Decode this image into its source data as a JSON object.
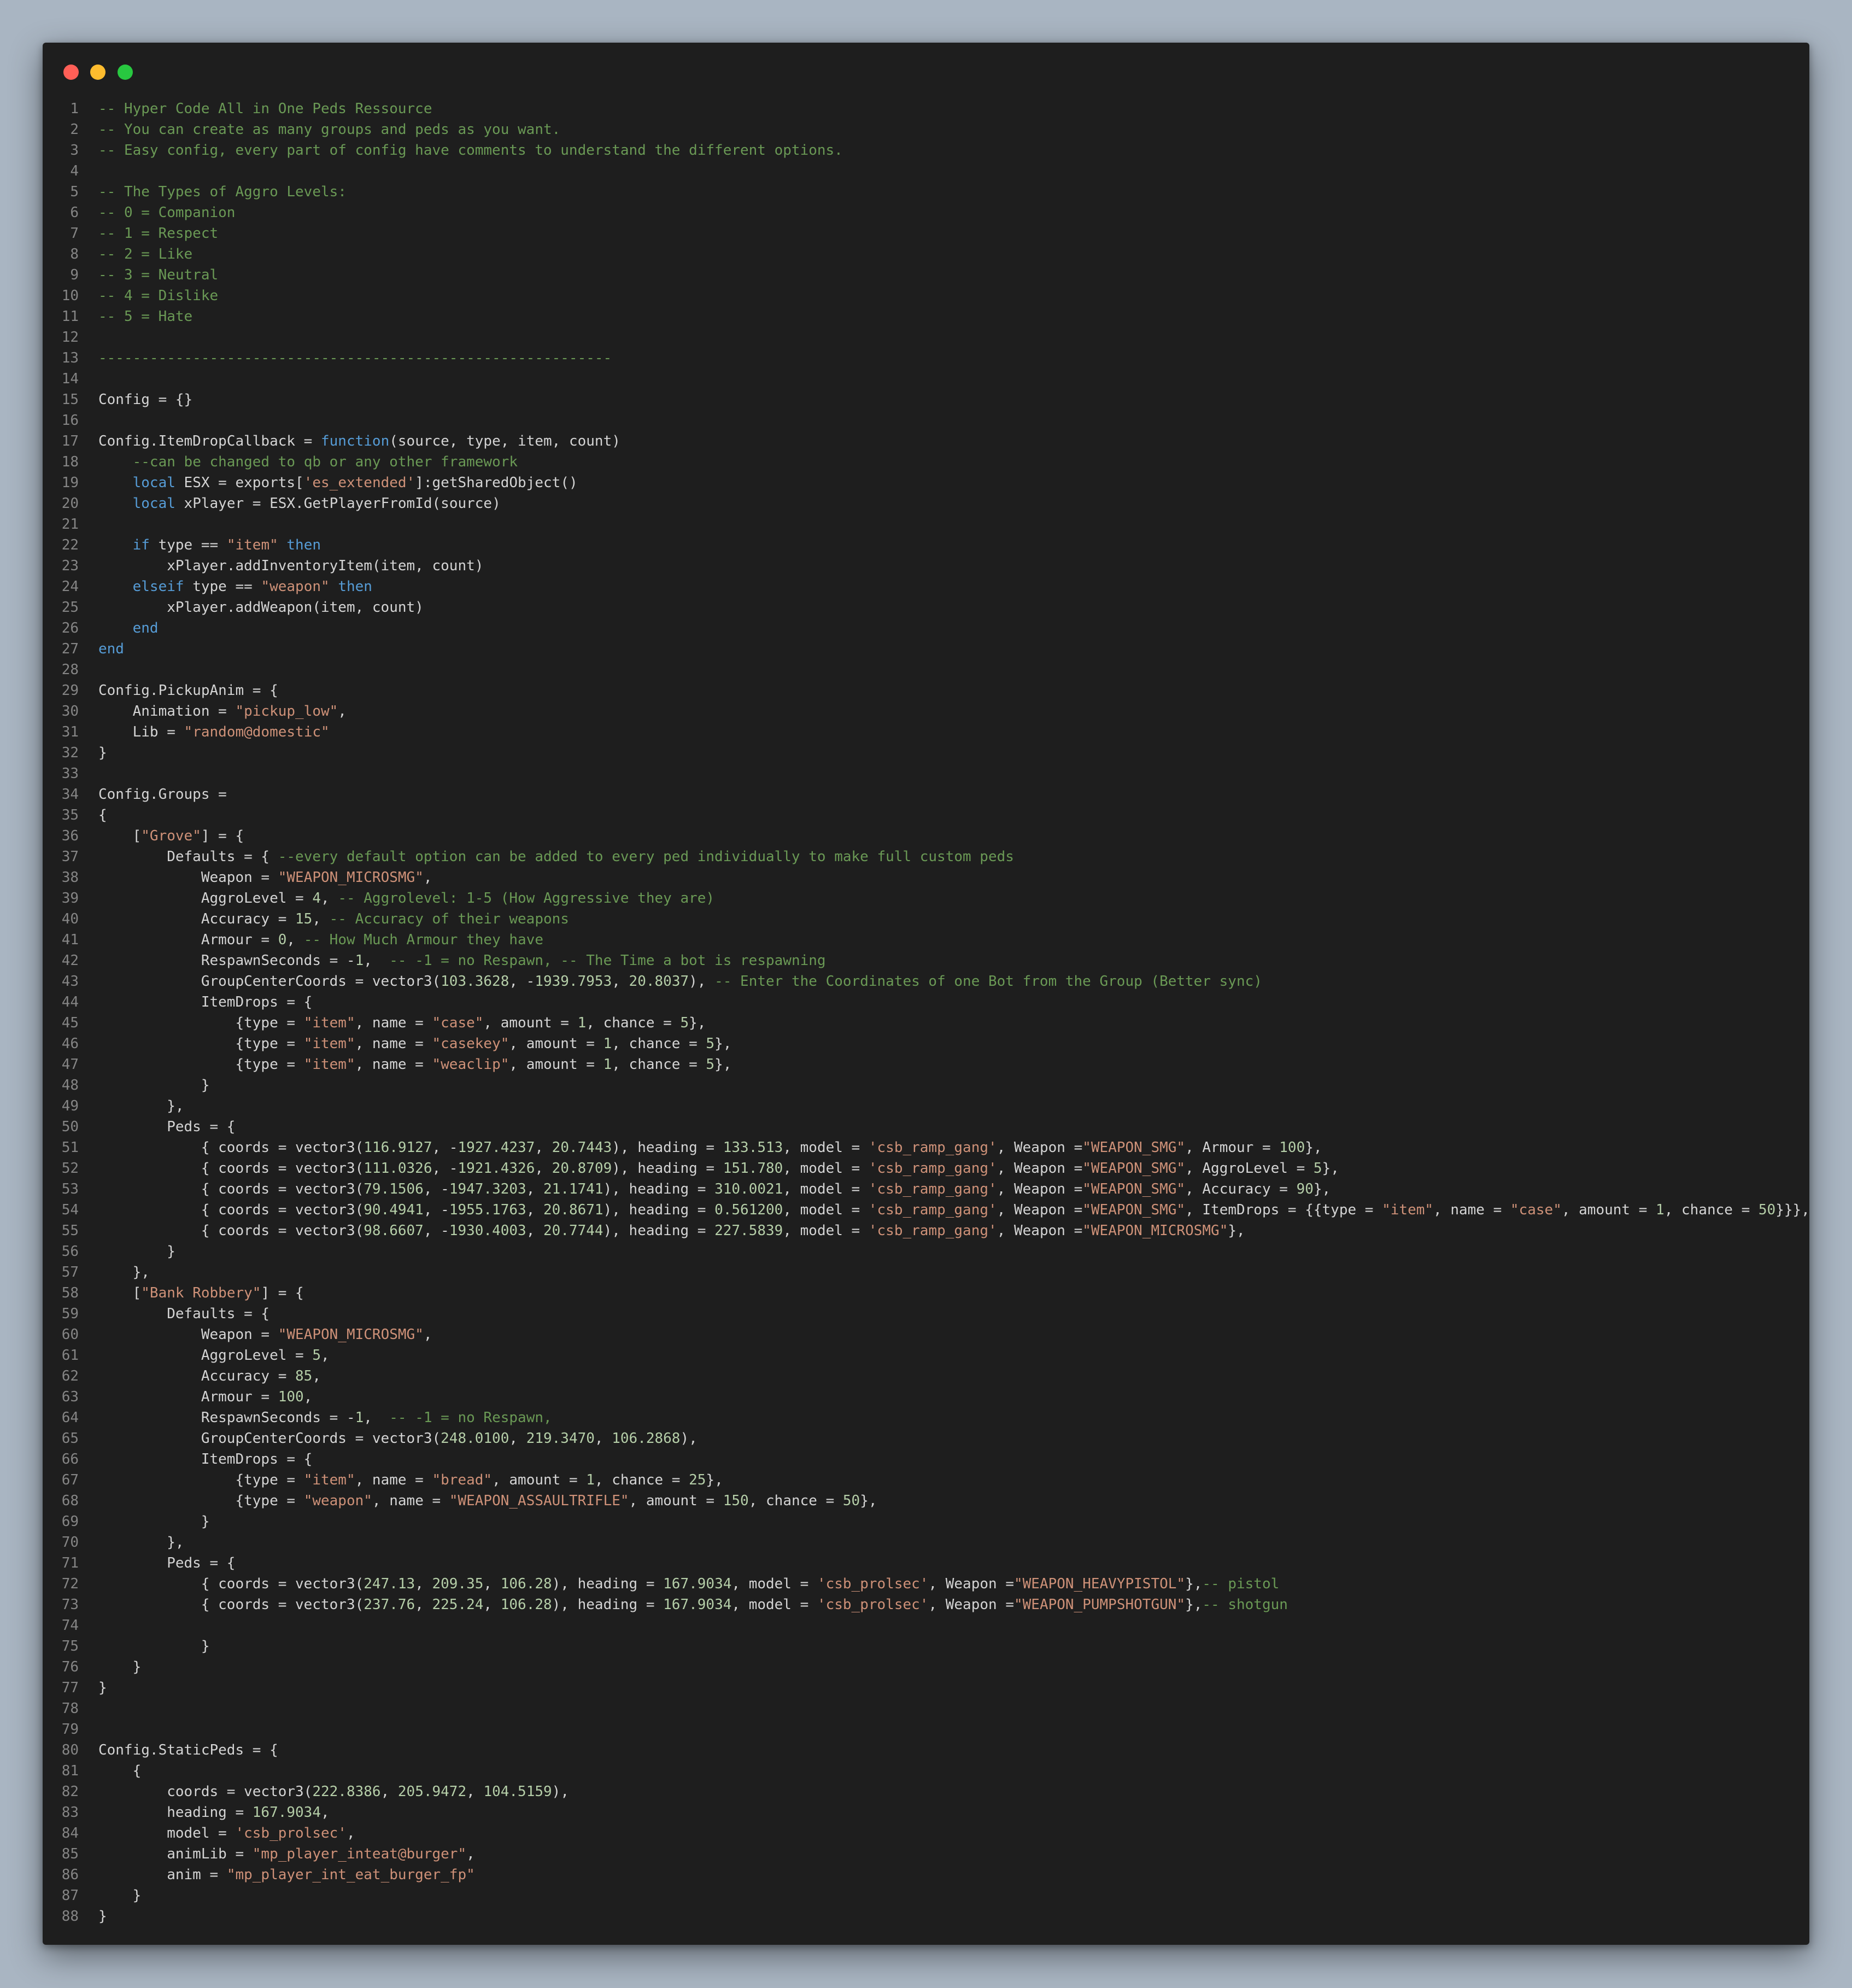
{
  "window": {
    "controls": [
      "close-dot",
      "minimize-dot",
      "maximize-dot"
    ],
    "colors": {
      "close": "#ff5f57",
      "minimize": "#febc2e",
      "maximize": "#28c840",
      "background": "#1e1e1e",
      "comment": "#6a9955",
      "keyword": "#569cd6",
      "string": "#ce9178",
      "number": "#b5cea8",
      "text": "#d4d4d4",
      "line_number": "#858585"
    }
  },
  "code": {
    "lines": [
      [
        [
          "c",
          "-- Hyper Code All in One Peds Ressource"
        ]
      ],
      [
        [
          "c",
          "-- You can create as many groups and peds as you want."
        ]
      ],
      [
        [
          "c",
          "-- Easy config, every part of config have comments to understand the different options."
        ]
      ],
      [],
      [
        [
          "c",
          "-- The Types of Aggro Levels:"
        ]
      ],
      [
        [
          "c",
          "-- 0 = Companion"
        ]
      ],
      [
        [
          "c",
          "-- 1 = Respect"
        ]
      ],
      [
        [
          "c",
          "-- 2 = Like"
        ]
      ],
      [
        [
          "c",
          "-- 3 = Neutral"
        ]
      ],
      [
        [
          "c",
          "-- 4 = Dislike"
        ]
      ],
      [
        [
          "c",
          "-- 5 = Hate"
        ]
      ],
      [],
      [
        [
          "c",
          "------------------------------------------------------------"
        ]
      ],
      [],
      [
        [
          "p",
          "Config = {}"
        ]
      ],
      [],
      [
        [
          "p",
          "Config.ItemDropCallback = "
        ],
        [
          "k",
          "function"
        ],
        [
          "p",
          "(source, type, item, count)"
        ]
      ],
      [
        [
          "p",
          "    "
        ],
        [
          "c",
          "--can be changed to qb or any other framework"
        ]
      ],
      [
        [
          "p",
          "    "
        ],
        [
          "k",
          "local"
        ],
        [
          "p",
          " ESX = exports["
        ],
        [
          "s",
          "'es_extended'"
        ],
        [
          "p",
          "]:getSharedObject()"
        ]
      ],
      [
        [
          "p",
          "    "
        ],
        [
          "k",
          "local"
        ],
        [
          "p",
          " xPlayer = ESX.GetPlayerFromId(source)"
        ]
      ],
      [],
      [
        [
          "p",
          "    "
        ],
        [
          "k",
          "if"
        ],
        [
          "p",
          " type == "
        ],
        [
          "s",
          "\"item\""
        ],
        [
          "p",
          " "
        ],
        [
          "k",
          "then"
        ]
      ],
      [
        [
          "p",
          "        xPlayer.addInventoryItem(item, count)"
        ]
      ],
      [
        [
          "p",
          "    "
        ],
        [
          "k",
          "elseif"
        ],
        [
          "p",
          " type == "
        ],
        [
          "s",
          "\"weapon\""
        ],
        [
          "p",
          " "
        ],
        [
          "k",
          "then"
        ]
      ],
      [
        [
          "p",
          "        xPlayer.addWeapon(item, count)"
        ]
      ],
      [
        [
          "p",
          "    "
        ],
        [
          "k",
          "end"
        ]
      ],
      [
        [
          "k",
          "end"
        ]
      ],
      [],
      [
        [
          "p",
          "Config.PickupAnim = {"
        ]
      ],
      [
        [
          "p",
          "    Animation = "
        ],
        [
          "s",
          "\"pickup_low\""
        ],
        [
          "p",
          ","
        ]
      ],
      [
        [
          "p",
          "    Lib = "
        ],
        [
          "s",
          "\"random@domestic\""
        ]
      ],
      [
        [
          "p",
          "}"
        ]
      ],
      [],
      [
        [
          "p",
          "Config.Groups ="
        ]
      ],
      [
        [
          "p",
          "{"
        ]
      ],
      [
        [
          "p",
          "    ["
        ],
        [
          "s",
          "\"Grove\""
        ],
        [
          "p",
          "] = {"
        ]
      ],
      [
        [
          "p",
          "        Defaults = { "
        ],
        [
          "c",
          "--every default option can be added to every ped individually to make full custom peds"
        ]
      ],
      [
        [
          "p",
          "            Weapon = "
        ],
        [
          "s",
          "\"WEAPON_MICROSMG\""
        ],
        [
          "p",
          ","
        ]
      ],
      [
        [
          "p",
          "            AggroLevel = "
        ],
        [
          "n",
          "4"
        ],
        [
          "p",
          ", "
        ],
        [
          "c",
          "-- Aggrolevel: 1-5 (How Aggressive they are)"
        ]
      ],
      [
        [
          "p",
          "            Accuracy = "
        ],
        [
          "n",
          "15"
        ],
        [
          "p",
          ", "
        ],
        [
          "c",
          "-- Accuracy of their weapons"
        ]
      ],
      [
        [
          "p",
          "            Armour = "
        ],
        [
          "n",
          "0"
        ],
        [
          "p",
          ", "
        ],
        [
          "c",
          "-- How Much Armour they have"
        ]
      ],
      [
        [
          "p",
          "            RespawnSeconds = -"
        ],
        [
          "n",
          "1"
        ],
        [
          "p",
          ",  "
        ],
        [
          "c",
          "-- -1 = no Respawn, -- The Time a bot is respawning"
        ]
      ],
      [
        [
          "p",
          "            GroupCenterCoords = vector3("
        ],
        [
          "n",
          "103.3628"
        ],
        [
          "p",
          ", -"
        ],
        [
          "n",
          "1939.7953"
        ],
        [
          "p",
          ", "
        ],
        [
          "n",
          "20.8037"
        ],
        [
          "p",
          "), "
        ],
        [
          "c",
          "-- Enter the Coordinates of one Bot from the Group (Better sync)"
        ]
      ],
      [
        [
          "p",
          "            ItemDrops = {"
        ]
      ],
      [
        [
          "p",
          "                {type = "
        ],
        [
          "s",
          "\"item\""
        ],
        [
          "p",
          ", name = "
        ],
        [
          "s",
          "\"case\""
        ],
        [
          "p",
          ", amount = "
        ],
        [
          "n",
          "1"
        ],
        [
          "p",
          ", chance = "
        ],
        [
          "n",
          "5"
        ],
        [
          "p",
          "},"
        ]
      ],
      [
        [
          "p",
          "                {type = "
        ],
        [
          "s",
          "\"item\""
        ],
        [
          "p",
          ", name = "
        ],
        [
          "s",
          "\"casekey\""
        ],
        [
          "p",
          ", amount = "
        ],
        [
          "n",
          "1"
        ],
        [
          "p",
          ", chance = "
        ],
        [
          "n",
          "5"
        ],
        [
          "p",
          "},"
        ]
      ],
      [
        [
          "p",
          "                {type = "
        ],
        [
          "s",
          "\"item\""
        ],
        [
          "p",
          ", name = "
        ],
        [
          "s",
          "\"weaclip\""
        ],
        [
          "p",
          ", amount = "
        ],
        [
          "n",
          "1"
        ],
        [
          "p",
          ", chance = "
        ],
        [
          "n",
          "5"
        ],
        [
          "p",
          "},"
        ]
      ],
      [
        [
          "p",
          "            }"
        ]
      ],
      [
        [
          "p",
          "        },"
        ]
      ],
      [
        [
          "p",
          "        Peds = {"
        ]
      ],
      [
        [
          "p",
          "            { coords = vector3("
        ],
        [
          "n",
          "116.9127"
        ],
        [
          "p",
          ", -"
        ],
        [
          "n",
          "1927.4237"
        ],
        [
          "p",
          ", "
        ],
        [
          "n",
          "20.7443"
        ],
        [
          "p",
          "), heading = "
        ],
        [
          "n",
          "133.513"
        ],
        [
          "p",
          ", model = "
        ],
        [
          "s",
          "'csb_ramp_gang'"
        ],
        [
          "p",
          ", Weapon ="
        ],
        [
          "s",
          "\"WEAPON_SMG\""
        ],
        [
          "p",
          ", Armour = "
        ],
        [
          "n",
          "100"
        ],
        [
          "p",
          "},"
        ]
      ],
      [
        [
          "p",
          "            { coords = vector3("
        ],
        [
          "n",
          "111.0326"
        ],
        [
          "p",
          ", -"
        ],
        [
          "n",
          "1921.4326"
        ],
        [
          "p",
          ", "
        ],
        [
          "n",
          "20.8709"
        ],
        [
          "p",
          "), heading = "
        ],
        [
          "n",
          "151.780"
        ],
        [
          "p",
          ", model = "
        ],
        [
          "s",
          "'csb_ramp_gang'"
        ],
        [
          "p",
          ", Weapon ="
        ],
        [
          "s",
          "\"WEAPON_SMG\""
        ],
        [
          "p",
          ", AggroLevel = "
        ],
        [
          "n",
          "5"
        ],
        [
          "p",
          "},"
        ]
      ],
      [
        [
          "p",
          "            { coords = vector3("
        ],
        [
          "n",
          "79.1506"
        ],
        [
          "p",
          ", -"
        ],
        [
          "n",
          "1947.3203"
        ],
        [
          "p",
          ", "
        ],
        [
          "n",
          "21.1741"
        ],
        [
          "p",
          "), heading = "
        ],
        [
          "n",
          "310.0021"
        ],
        [
          "p",
          ", model = "
        ],
        [
          "s",
          "'csb_ramp_gang'"
        ],
        [
          "p",
          ", Weapon ="
        ],
        [
          "s",
          "\"WEAPON_SMG\""
        ],
        [
          "p",
          ", Accuracy = "
        ],
        [
          "n",
          "90"
        ],
        [
          "p",
          "},"
        ]
      ],
      [
        [
          "p",
          "            { coords = vector3("
        ],
        [
          "n",
          "90.4941"
        ],
        [
          "p",
          ", -"
        ],
        [
          "n",
          "1955.1763"
        ],
        [
          "p",
          ", "
        ],
        [
          "n",
          "20.8671"
        ],
        [
          "p",
          "), heading = "
        ],
        [
          "n",
          "0.561200"
        ],
        [
          "p",
          ", model = "
        ],
        [
          "s",
          "'csb_ramp_gang'"
        ],
        [
          "p",
          ", Weapon ="
        ],
        [
          "s",
          "\"WEAPON_SMG\""
        ],
        [
          "p",
          ", ItemDrops = {{type = "
        ],
        [
          "s",
          "\"item\""
        ],
        [
          "p",
          ", name = "
        ],
        [
          "s",
          "\"case\""
        ],
        [
          "p",
          ", amount = "
        ],
        [
          "n",
          "1"
        ],
        [
          "p",
          ", chance = "
        ],
        [
          "n",
          "50"
        ],
        [
          "p",
          "}}},"
        ]
      ],
      [
        [
          "p",
          "            { coords = vector3("
        ],
        [
          "n",
          "98.6607"
        ],
        [
          "p",
          ", -"
        ],
        [
          "n",
          "1930.4003"
        ],
        [
          "p",
          ", "
        ],
        [
          "n",
          "20.7744"
        ],
        [
          "p",
          "), heading = "
        ],
        [
          "n",
          "227.5839"
        ],
        [
          "p",
          ", model = "
        ],
        [
          "s",
          "'csb_ramp_gang'"
        ],
        [
          "p",
          ", Weapon ="
        ],
        [
          "s",
          "\"WEAPON_MICROSMG\""
        ],
        [
          "p",
          "},"
        ]
      ],
      [
        [
          "p",
          "        }"
        ]
      ],
      [
        [
          "p",
          "    },"
        ]
      ],
      [
        [
          "p",
          "    ["
        ],
        [
          "s",
          "\"Bank Robbery\""
        ],
        [
          "p",
          "] = {"
        ]
      ],
      [
        [
          "p",
          "        Defaults = {"
        ]
      ],
      [
        [
          "p",
          "            Weapon = "
        ],
        [
          "s",
          "\"WEAPON_MICROSMG\""
        ],
        [
          "p",
          ","
        ]
      ],
      [
        [
          "p",
          "            AggroLevel = "
        ],
        [
          "n",
          "5"
        ],
        [
          "p",
          ","
        ]
      ],
      [
        [
          "p",
          "            Accuracy = "
        ],
        [
          "n",
          "85"
        ],
        [
          "p",
          ","
        ]
      ],
      [
        [
          "p",
          "            Armour = "
        ],
        [
          "n",
          "100"
        ],
        [
          "p",
          ","
        ]
      ],
      [
        [
          "p",
          "            RespawnSeconds = -"
        ],
        [
          "n",
          "1"
        ],
        [
          "p",
          ",  "
        ],
        [
          "c",
          "-- -1 = no Respawn,"
        ]
      ],
      [
        [
          "p",
          "            GroupCenterCoords = vector3("
        ],
        [
          "n",
          "248.0100"
        ],
        [
          "p",
          ", "
        ],
        [
          "n",
          "219.3470"
        ],
        [
          "p",
          ", "
        ],
        [
          "n",
          "106.2868"
        ],
        [
          "p",
          "),"
        ]
      ],
      [
        [
          "p",
          "            ItemDrops = {"
        ]
      ],
      [
        [
          "p",
          "                {type = "
        ],
        [
          "s",
          "\"item\""
        ],
        [
          "p",
          ", name = "
        ],
        [
          "s",
          "\"bread\""
        ],
        [
          "p",
          ", amount = "
        ],
        [
          "n",
          "1"
        ],
        [
          "p",
          ", chance = "
        ],
        [
          "n",
          "25"
        ],
        [
          "p",
          "},"
        ]
      ],
      [
        [
          "p",
          "                {type = "
        ],
        [
          "s",
          "\"weapon\""
        ],
        [
          "p",
          ", name = "
        ],
        [
          "s",
          "\"WEAPON_ASSAULTRIFLE\""
        ],
        [
          "p",
          ", amount = "
        ],
        [
          "n",
          "150"
        ],
        [
          "p",
          ", chance = "
        ],
        [
          "n",
          "50"
        ],
        [
          "p",
          "},"
        ]
      ],
      [
        [
          "p",
          "            }"
        ]
      ],
      [
        [
          "p",
          "        },"
        ]
      ],
      [
        [
          "p",
          "        Peds = {"
        ]
      ],
      [
        [
          "p",
          "            { coords = vector3("
        ],
        [
          "n",
          "247.13"
        ],
        [
          "p",
          ", "
        ],
        [
          "n",
          "209.35"
        ],
        [
          "p",
          ", "
        ],
        [
          "n",
          "106.28"
        ],
        [
          "p",
          "), heading = "
        ],
        [
          "n",
          "167.9034"
        ],
        [
          "p",
          ", model = "
        ],
        [
          "s",
          "'csb_prolsec'"
        ],
        [
          "p",
          ", Weapon ="
        ],
        [
          "s",
          "\"WEAPON_HEAVYPISTOL\""
        ],
        [
          "p",
          "},"
        ],
        [
          "c",
          "-- pistol"
        ]
      ],
      [
        [
          "p",
          "            { coords = vector3("
        ],
        [
          "n",
          "237.76"
        ],
        [
          "p",
          ", "
        ],
        [
          "n",
          "225.24"
        ],
        [
          "p",
          ", "
        ],
        [
          "n",
          "106.28"
        ],
        [
          "p",
          "), heading = "
        ],
        [
          "n",
          "167.9034"
        ],
        [
          "p",
          ", model = "
        ],
        [
          "s",
          "'csb_prolsec'"
        ],
        [
          "p",
          ", Weapon ="
        ],
        [
          "s",
          "\"WEAPON_PUMPSHOTGUN\""
        ],
        [
          "p",
          "},"
        ],
        [
          "c",
          "-- shotgun"
        ]
      ],
      [],
      [
        [
          "p",
          "            }"
        ]
      ],
      [
        [
          "p",
          "    }"
        ]
      ],
      [
        [
          "p",
          "}"
        ]
      ],
      [],
      [],
      [
        [
          "p",
          "Config.StaticPeds = {"
        ]
      ],
      [
        [
          "p",
          "    {"
        ]
      ],
      [
        [
          "p",
          "        coords = vector3("
        ],
        [
          "n",
          "222.8386"
        ],
        [
          "p",
          ", "
        ],
        [
          "n",
          "205.9472"
        ],
        [
          "p",
          ", "
        ],
        [
          "n",
          "104.5159"
        ],
        [
          "p",
          "),"
        ]
      ],
      [
        [
          "p",
          "        heading = "
        ],
        [
          "n",
          "167.9034"
        ],
        [
          "p",
          ","
        ]
      ],
      [
        [
          "p",
          "        model = "
        ],
        [
          "s",
          "'csb_prolsec'"
        ],
        [
          "p",
          ","
        ]
      ],
      [
        [
          "p",
          "        animLib = "
        ],
        [
          "s",
          "\"mp_player_inteat@burger\""
        ],
        [
          "p",
          ","
        ]
      ],
      [
        [
          "p",
          "        anim = "
        ],
        [
          "s",
          "\"mp_player_int_eat_burger_fp\""
        ]
      ],
      [
        [
          "p",
          "    }"
        ]
      ],
      [
        [
          "p",
          "}"
        ]
      ]
    ]
  }
}
